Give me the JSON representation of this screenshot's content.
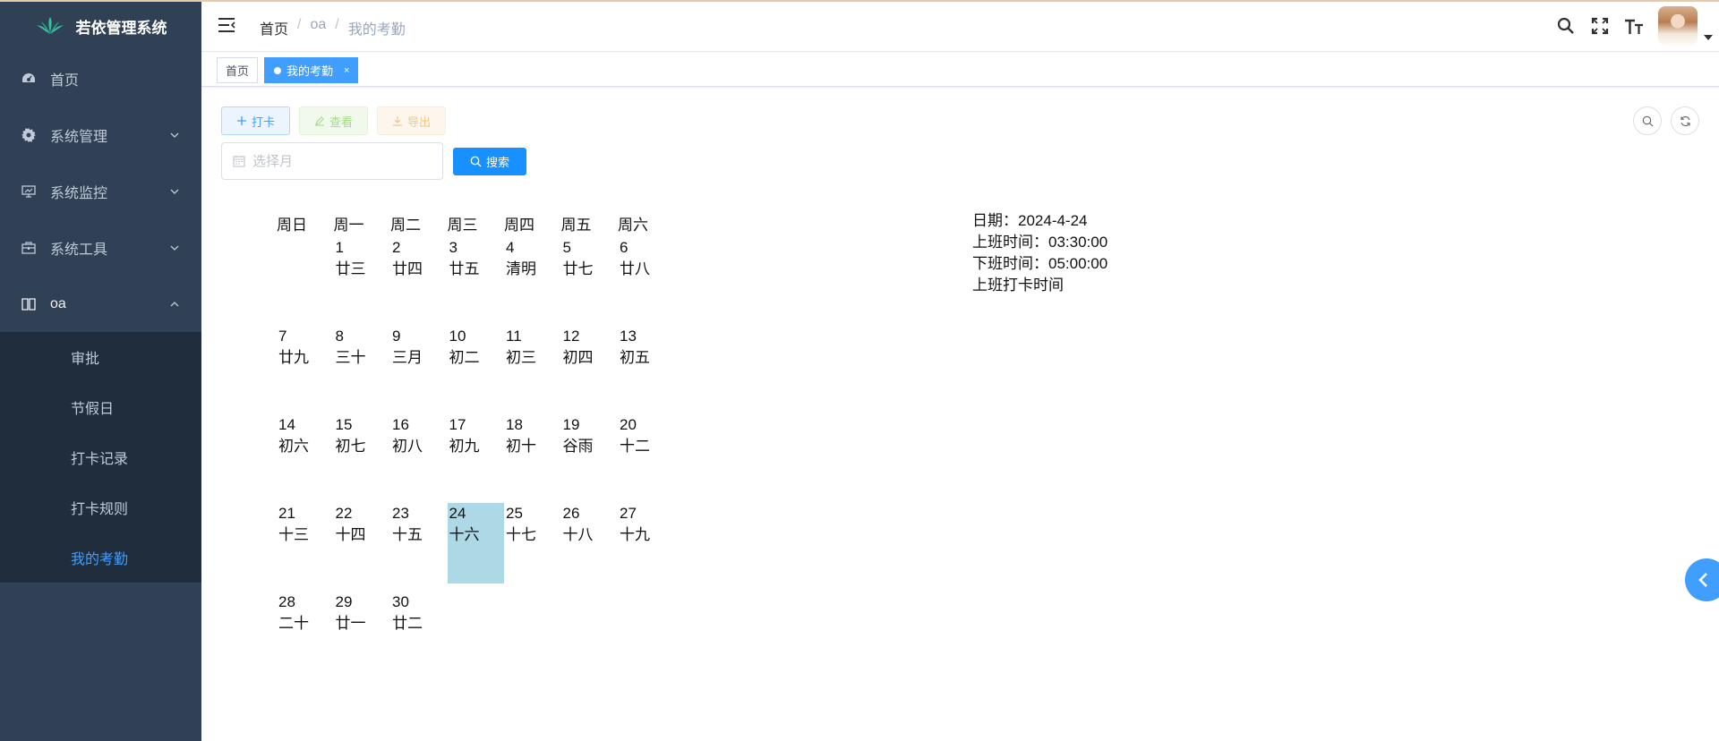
{
  "sidebar": {
    "logo_text": "若依管理系统",
    "menu": {
      "home": "首页",
      "system": "系统管理",
      "monitor": "系统监控",
      "tool": "系统工具",
      "oa": "oa"
    },
    "oa_items": {
      "approval": "审批",
      "holiday": "节假日",
      "clock_record": "打卡记录",
      "clock_rule": "打卡规则",
      "my_attendance": "我的考勤"
    }
  },
  "navbar": {
    "breadcrumb": {
      "home": "首页",
      "section": "oa",
      "page": "我的考勤",
      "separator": "/"
    }
  },
  "tags": {
    "home": "首页",
    "active": "我的考勤",
    "close": "×"
  },
  "toolbar": {
    "clock_in": "打卡",
    "view": "查看",
    "export": "导出"
  },
  "filter": {
    "month_placeholder": "选择月",
    "search": "搜索"
  },
  "calendar": {
    "weekdays": [
      "周日",
      "周一",
      "周二",
      "周三",
      "周四",
      "周五",
      "周六"
    ],
    "weeks": [
      [
        null,
        {
          "d": "1",
          "l": "廿三"
        },
        {
          "d": "2",
          "l": "廿四"
        },
        {
          "d": "3",
          "l": "廿五"
        },
        {
          "d": "4",
          "l": "清明"
        },
        {
          "d": "5",
          "l": "廿七"
        },
        {
          "d": "6",
          "l": "廿八"
        }
      ],
      [
        {
          "d": "7",
          "l": "廿九"
        },
        {
          "d": "8",
          "l": "三十"
        },
        {
          "d": "9",
          "l": "三月"
        },
        {
          "d": "10",
          "l": "初二"
        },
        {
          "d": "11",
          "l": "初三"
        },
        {
          "d": "12",
          "l": "初四"
        },
        {
          "d": "13",
          "l": "初五"
        }
      ],
      [
        {
          "d": "14",
          "l": "初六"
        },
        {
          "d": "15",
          "l": "初七"
        },
        {
          "d": "16",
          "l": "初八"
        },
        {
          "d": "17",
          "l": "初九"
        },
        {
          "d": "18",
          "l": "初十"
        },
        {
          "d": "19",
          "l": "谷雨"
        },
        {
          "d": "20",
          "l": "十二"
        }
      ],
      [
        {
          "d": "21",
          "l": "十三"
        },
        {
          "d": "22",
          "l": "十四"
        },
        {
          "d": "23",
          "l": "十五"
        },
        {
          "d": "24",
          "l": "十六",
          "selected": true
        },
        {
          "d": "25",
          "l": "十七"
        },
        {
          "d": "26",
          "l": "十八"
        },
        {
          "d": "27",
          "l": "十九"
        }
      ],
      [
        {
          "d": "28",
          "l": "二十"
        },
        {
          "d": "29",
          "l": "廿一"
        },
        {
          "d": "30",
          "l": "廿二"
        },
        null,
        null,
        null,
        null
      ]
    ],
    "selected_color": "#add8e6"
  },
  "info": {
    "date": "日期：2024-4-24",
    "start_time": "上班时间：03:30:00",
    "end_time": "下班时间：05:00:00",
    "clock_in_time": "上班打卡时间"
  },
  "colors": {
    "sidebar_bg": "#304156",
    "submenu_bg": "#1f2d3d",
    "primary": "#409eff",
    "search_btn": "#1890ff"
  }
}
